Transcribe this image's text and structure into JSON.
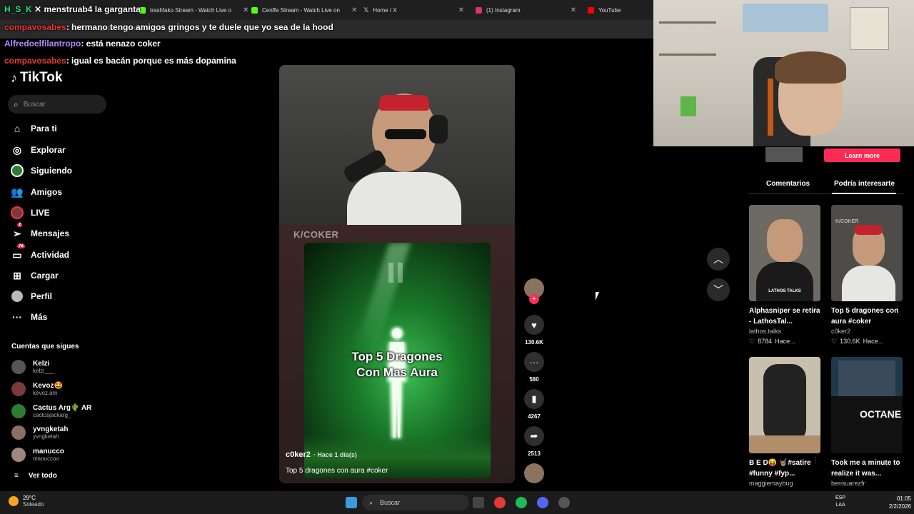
{
  "browser": {
    "tabs": [
      {
        "label": "trashfako Stream - Watch Live o",
        "icon_color": "#53fc18"
      },
      {
        "label": "Cenffe Stream - Watch Live on",
        "icon_color": "#53fc18"
      },
      {
        "label": "Home / X",
        "icon_color": "#ffffff"
      },
      {
        "label": "(1) Instagram",
        "icon_color": "#e1306c"
      },
      {
        "label": "YouTube",
        "icon_color": "#ff0000"
      }
    ],
    "url": "tiktok.com/@c0ker2/video/7597251..."
  },
  "overlay": {
    "channel_label": "H_S_K",
    "stream_title": "menstruab4 la garganta",
    "chat": [
      {
        "user": "compavosabes",
        "message": ": hermano tengo amigos gringos y te duele que yo sea de la hood"
      },
      {
        "user": "Alfredoelfilantropo",
        "message": ": está nenazo coker"
      },
      {
        "user": "compavosabes",
        "message": ": igual es bacán porque es más dopamina"
      }
    ]
  },
  "tiktok": {
    "logo": "TikTok",
    "search_placeholder": "Buscar",
    "nav": [
      {
        "label": "Para ti",
        "icon": "home-icon",
        "badge": ""
      },
      {
        "label": "Explorar",
        "icon": "compass-icon",
        "badge": ""
      },
      {
        "label": "Siguiendo",
        "icon": "following-icon",
        "badge": ""
      },
      {
        "label": "Amigos",
        "icon": "friends-icon",
        "badge": ""
      },
      {
        "label": "LIVE",
        "icon": "live-icon",
        "badge": ""
      },
      {
        "label": "Mensajes",
        "icon": "messages-icon",
        "badge": "2"
      },
      {
        "label": "Actividad",
        "icon": "activity-icon",
        "badge": "78"
      },
      {
        "label": "Cargar",
        "icon": "upload-icon",
        "badge": ""
      },
      {
        "label": "Perfil",
        "icon": "profile-icon",
        "badge": ""
      },
      {
        "label": "Más",
        "icon": "more-icon",
        "badge": ""
      }
    ],
    "following_title": "Cuentas que sigues",
    "following": [
      {
        "name": "Kelzi",
        "handle": "kelzi___",
        "color": "#555"
      },
      {
        "name": "Kevoz🤩",
        "handle": "kevoz.am",
        "color": "#7a3a3a"
      },
      {
        "name": "Cactus Arg🌵 AR",
        "handle": "cactusjackarg_",
        "color": "#2e7d32"
      },
      {
        "name": "yvngketah",
        "handle": "yvngketah",
        "color": "#8d6e63"
      },
      {
        "name": "manucco",
        "handle": "manuccoo",
        "color": "#a1887f"
      }
    ],
    "see_all": "Ver todo",
    "video": {
      "watermark": "K/COKER",
      "overlay_title_line1": "Top 5 Dragones",
      "overlay_title_line2": "Con Mas Aura",
      "author": "c0ker2",
      "age": "· Hace 1 día(s)",
      "caption": "Top 5 dragones con aura #coker"
    },
    "actions": {
      "likes": "130.6K",
      "comments": "580",
      "saves": "4267",
      "shares": "2513"
    },
    "right_panel": {
      "learn_more": "Learn more",
      "tab_comments": "Comentarios",
      "tab_related": "Podría interesarte",
      "cards": [
        {
          "title": "Alphasniper se retira - LathosTal...",
          "author": "lathos.talks",
          "likes": "8784",
          "age": "Hace...",
          "bg": "#6d6a63",
          "label": "LATHOS TALKS"
        },
        {
          "title": "Top 5 dragones con aura #coker",
          "author": "c0ker2",
          "likes": "130.6K",
          "age": "Hace...",
          "bg": "#4d4c49",
          "label": "K/COKER"
        },
        {
          "title": "B E D😝 🤘🏽#satire #funny #fyp...",
          "author": "maggiemaybug",
          "likes": "",
          "age": "",
          "bg": "#c9bfae",
          "label": ""
        },
        {
          "title": "Took me a minute to realize it was...",
          "author": "bensuarezfr",
          "likes": "",
          "age": "",
          "bg": "#1e3a4a",
          "label": "OCTANE"
        }
      ]
    }
  },
  "taskbar": {
    "temp": "29°C",
    "condition": "Soleado",
    "search": "Buscar",
    "lang1": "ESP",
    "lang2": "LAA",
    "time": "01:05",
    "date": "2/2/2026"
  }
}
